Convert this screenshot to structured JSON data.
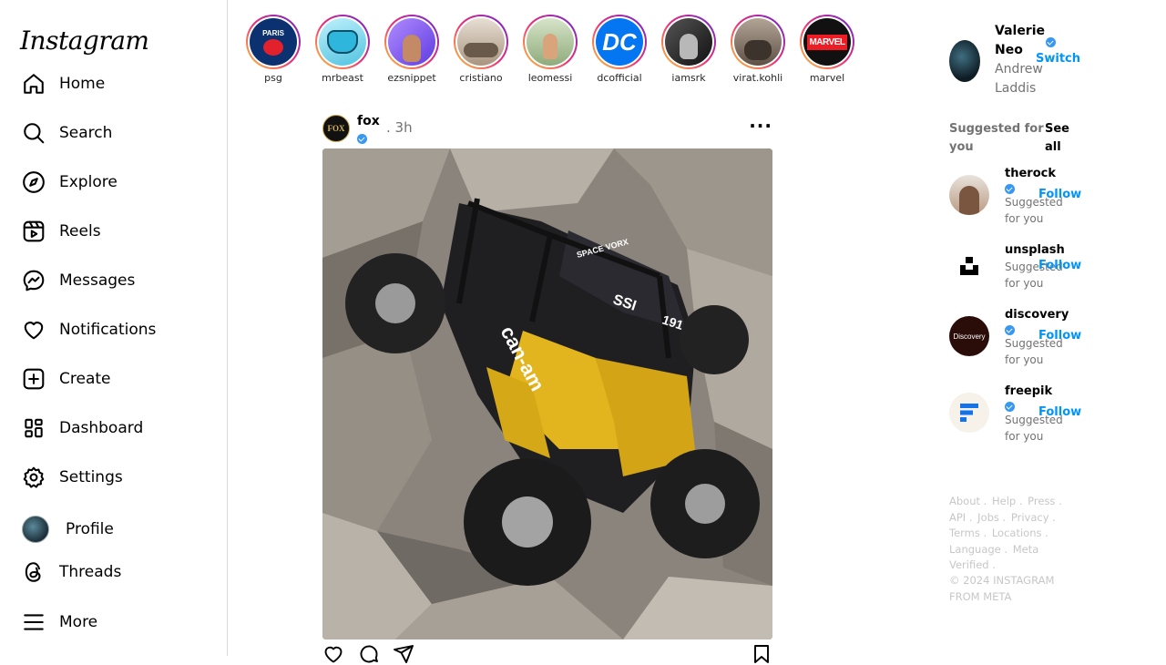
{
  "app": {
    "logo": "Instagram"
  },
  "nav": [
    {
      "label": "Home",
      "icon": "home-icon"
    },
    {
      "label": "Search",
      "icon": "search-icon"
    },
    {
      "label": "Explore",
      "icon": "compass-icon"
    },
    {
      "label": "Reels",
      "icon": "reels-icon"
    },
    {
      "label": "Messages",
      "icon": "messenger-icon"
    },
    {
      "label": "Notifications",
      "icon": "heart-icon"
    },
    {
      "label": "Create",
      "icon": "plus-square-icon"
    },
    {
      "label": "Dashboard",
      "icon": "dashboard-icon"
    },
    {
      "label": "Settings",
      "icon": "gear-icon"
    },
    {
      "label": "Profile",
      "icon": "avatar"
    },
    {
      "label": "Threads",
      "icon": "threads-icon"
    },
    {
      "label": "More",
      "icon": "menu-icon"
    }
  ],
  "stories": [
    {
      "name": "psg",
      "avatar_text": "PARIS",
      "bg": "#0c3170",
      "fg": "#ffffff"
    },
    {
      "name": "mrbeast",
      "avatar_text": "",
      "bg": "#7ad6e8",
      "fg": "#ffffff"
    },
    {
      "name": "ezsnippet",
      "avatar_text": "",
      "bg": "#8e6ff0",
      "fg": "#ffffff"
    },
    {
      "name": "cristiano",
      "avatar_text": "",
      "bg": "#c9b9a6",
      "fg": "#ffffff"
    },
    {
      "name": "leomessi",
      "avatar_text": "",
      "bg": "#9bb98c",
      "fg": "#ffffff"
    },
    {
      "name": "dcofficial",
      "avatar_text": "DC",
      "bg": "#0476f2",
      "fg": "#ffffff"
    },
    {
      "name": "iamsrk",
      "avatar_text": "",
      "bg": "#2b2b2b",
      "fg": "#ffffff"
    },
    {
      "name": "virat.kohli",
      "avatar_text": "",
      "bg": "#7f6d5d",
      "fg": "#ffffff"
    },
    {
      "name": "marvel",
      "avatar_text": "MARVEL",
      "bg": "#ec1d24",
      "fg": "#ffffff"
    }
  ],
  "post": {
    "username": "fox",
    "avatar_text": "FOX",
    "time": ". 3h",
    "more": "···",
    "image_text": {
      "brand": "can-am",
      "sponsor": "SSI",
      "number": "191",
      "sticker": "SPACE VORX"
    }
  },
  "current_user": {
    "username": "Valerie Neo",
    "full_name": "Andrew Laddis",
    "switch_label": "Switch"
  },
  "suggestions": {
    "title": "Suggested for you",
    "see_all": "See all",
    "items": [
      {
        "username": "therock",
        "subtitle": "Suggested for you",
        "follow": "Follow",
        "avatar_text": ""
      },
      {
        "username": "unsplash",
        "subtitle": "Suggested for you",
        "follow": "Follow",
        "avatar_text": ""
      },
      {
        "username": "discovery",
        "subtitle": "Suggested for you",
        "follow": "Follow",
        "avatar_text": "Discovery"
      },
      {
        "username": "freepik",
        "subtitle": "Suggested for you",
        "follow": "Follow",
        "avatar_text": ""
      }
    ]
  },
  "footer": {
    "links": [
      "About .",
      "Help .",
      "Press .",
      "API .",
      "Jobs .",
      "Privacy .",
      "Terms .",
      "Locations .",
      "Language .",
      "Meta Verified ."
    ],
    "copyright": "© 2024 INSTAGRAM FROM META"
  },
  "colors": {
    "accent": "#0095f6",
    "verified": "#3897f0",
    "muted": "#737373",
    "border": "#dbdbdb"
  }
}
